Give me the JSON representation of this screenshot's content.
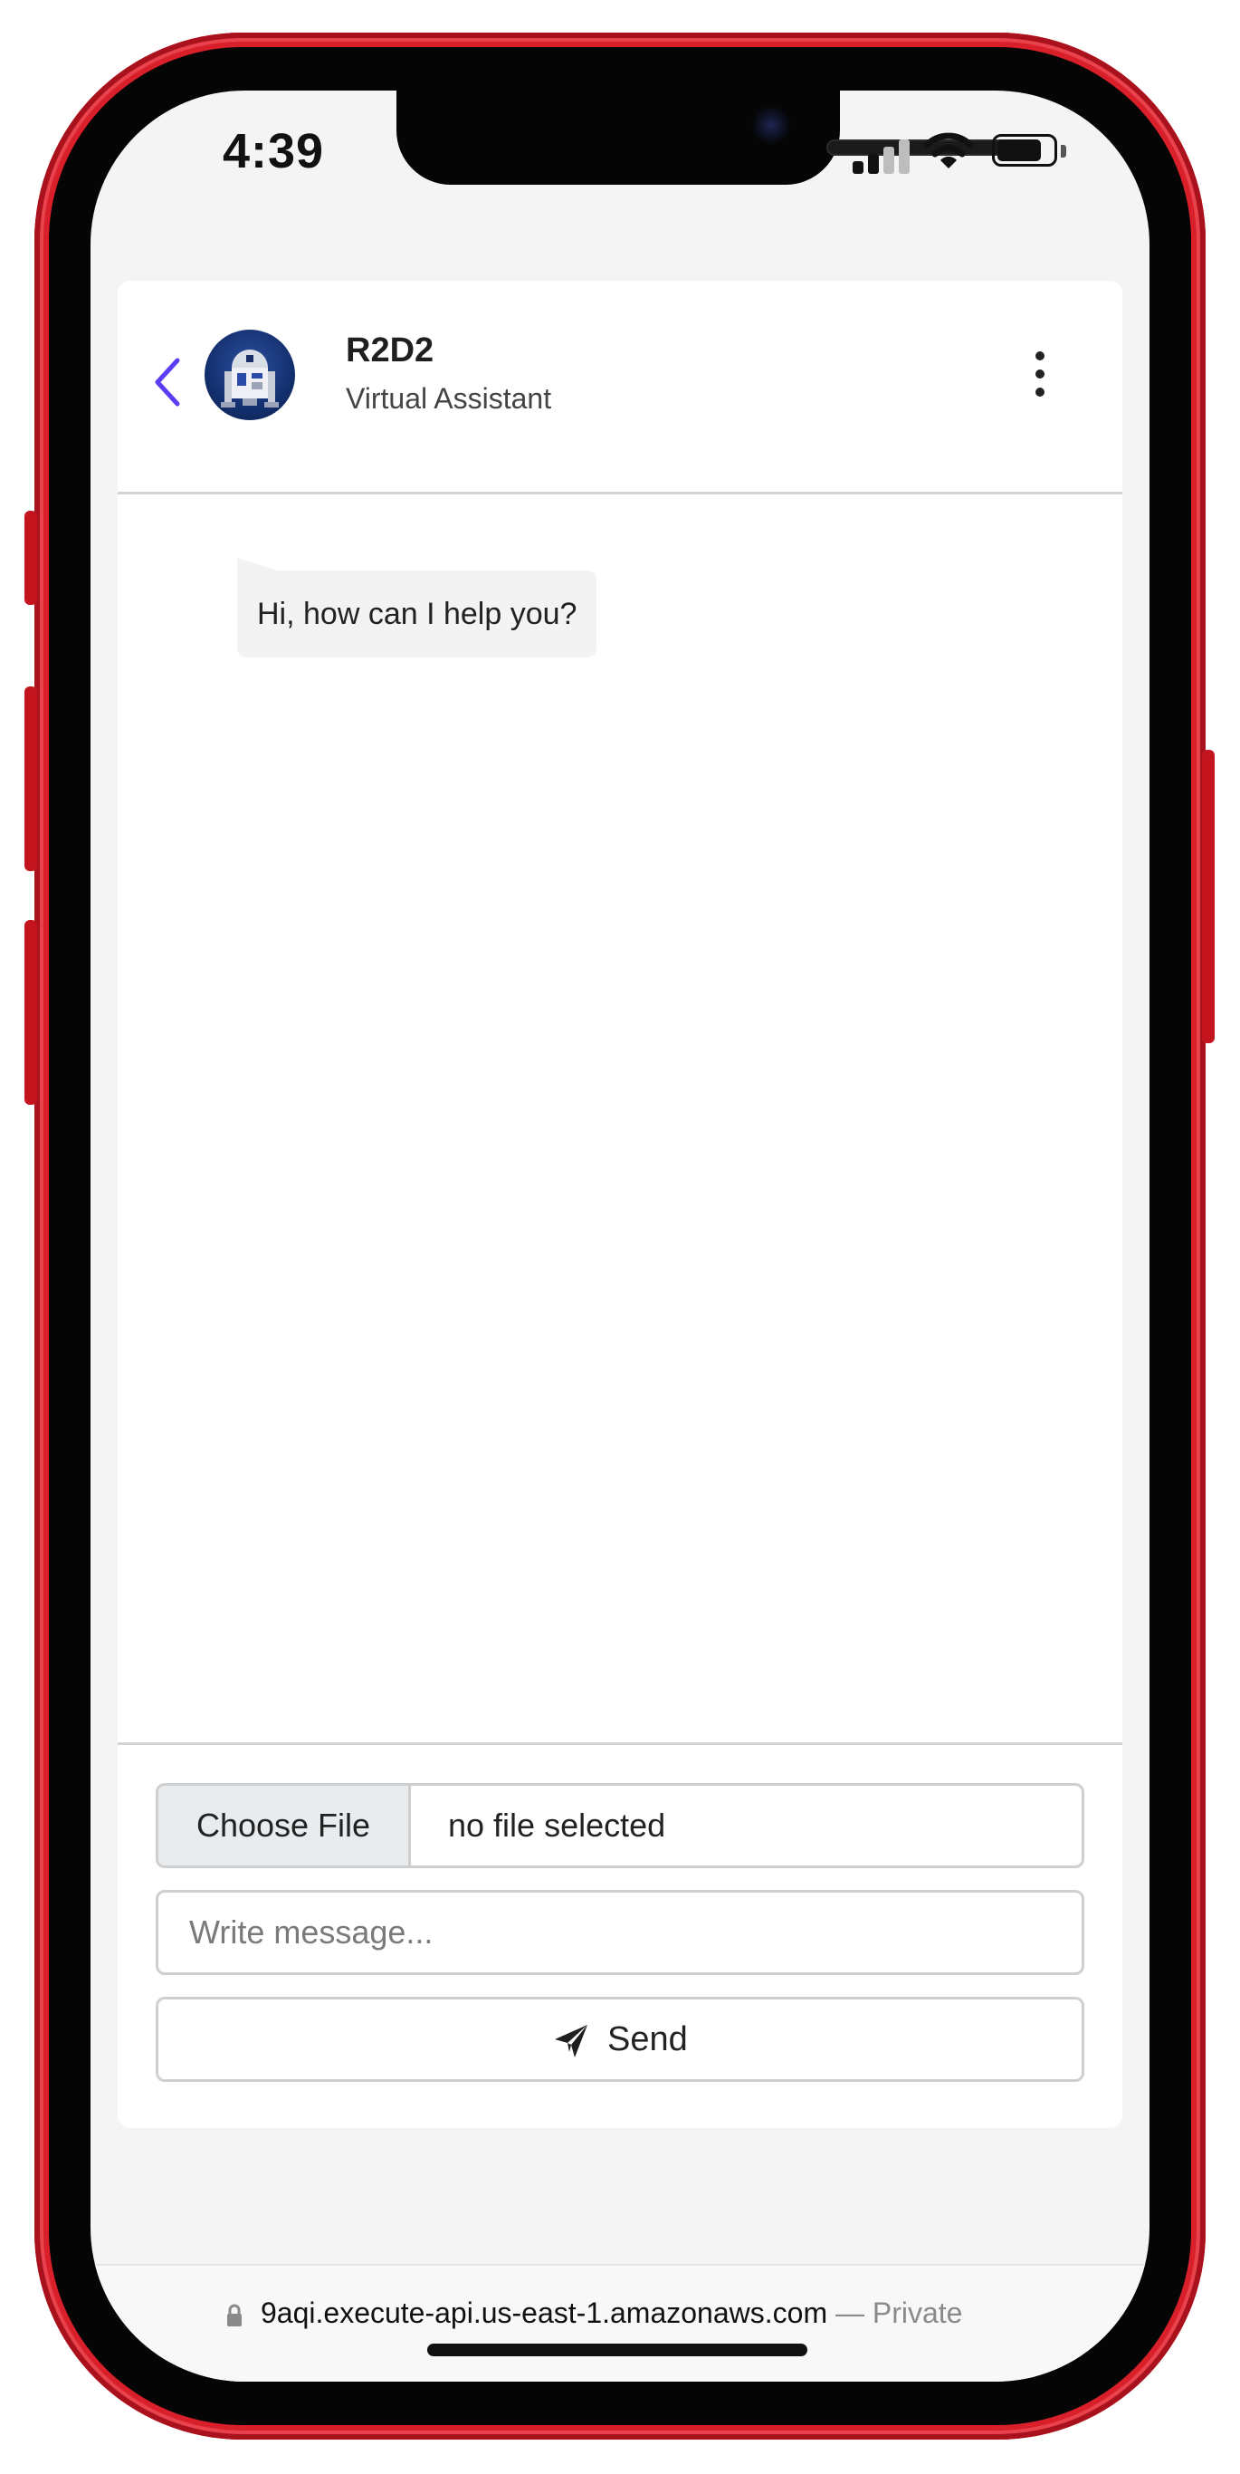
{
  "status_bar": {
    "time": "4:39",
    "signal_bars_active": 2,
    "signal_bars_total": 4,
    "battery_level_percent": 80
  },
  "chat": {
    "header": {
      "bot_name": "R2D2",
      "bot_role": "Virtual Assistant"
    },
    "messages": [
      {
        "from": "bot",
        "text": "Hi, how can I help you?"
      }
    ],
    "composer": {
      "choose_file_label": "Choose File",
      "file_status": "no file selected",
      "message_placeholder": "Write message...",
      "send_label": "Send"
    }
  },
  "browser": {
    "url": "9aqi.execute-api.us-east-1.amazonaws.com",
    "privacy_label": "— Private"
  },
  "colors": {
    "phone_frame": "#d91f2a",
    "back_chevron": "#5b3df5",
    "avatar_background": "#13306f"
  }
}
